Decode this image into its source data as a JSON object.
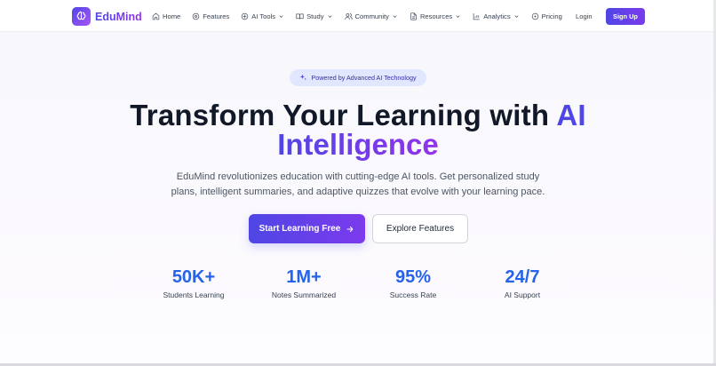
{
  "brand": {
    "name": "EduMind",
    "logo_icon": "brain-icon"
  },
  "nav": {
    "items": [
      {
        "label": "Home",
        "icon": "home-icon",
        "dropdown": false
      },
      {
        "label": "Features",
        "icon": "settings-icon",
        "dropdown": false
      },
      {
        "label": "AI Tools",
        "icon": "cpu-icon",
        "dropdown": true
      },
      {
        "label": "Study",
        "icon": "book-icon",
        "dropdown": true
      },
      {
        "label": "Community",
        "icon": "users-icon",
        "dropdown": true
      },
      {
        "label": "Resources",
        "icon": "file-icon",
        "dropdown": true
      },
      {
        "label": "Analytics",
        "icon": "bar-chart-icon",
        "dropdown": true
      },
      {
        "label": "Pricing",
        "icon": "tag-icon",
        "dropdown": false
      }
    ],
    "login": "Login",
    "signup": "Sign Up"
  },
  "hero": {
    "badge": "Powered by Advanced AI Technology",
    "headline_part1": "Transform Your Learning with ",
    "headline_ai": "AI",
    "headline_part2": "Intelligence",
    "subtitle": "EduMind revolutionizes education with cutting-edge AI tools. Get personalized study plans, intelligent summaries, and adaptive quizzes that evolve with your learning pace.",
    "primary_cta": "Start Learning Free",
    "secondary_cta": "Explore Features"
  },
  "stats": [
    {
      "value": "50K+",
      "label": "Students Learning"
    },
    {
      "value": "1M+",
      "label": "Notes Summarized"
    },
    {
      "value": "95%",
      "label": "Success Rate"
    },
    {
      "value": "24/7",
      "label": "AI Support"
    }
  ],
  "colors": {
    "accent": "#4f46e5",
    "accent_end": "#9333ea",
    "stat": "#2563eb",
    "badge_bg": "#e0e7ff"
  }
}
